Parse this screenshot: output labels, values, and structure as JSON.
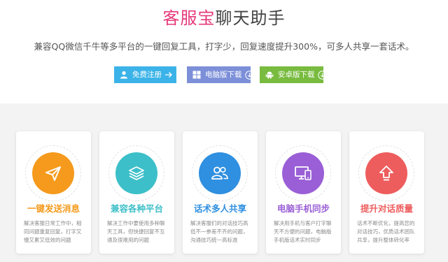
{
  "header": {
    "title_brand": "客服宝",
    "title_rest": "聊天助手",
    "subtitle": "兼容QQ微信千牛等多平台的一键回复工具，打字少，回复速度提升300%，可多人共享一套话术。",
    "brand_color": "#e6397a"
  },
  "buttons": [
    {
      "label": "免费注册",
      "icon": "user-icon",
      "tail_icon": "arrow-right-icon",
      "color": "#3bb3e8"
    },
    {
      "label": "电脑版下载",
      "icon": "windows-icon",
      "tail_icon": "download-icon",
      "color": "#7c8fd8"
    },
    {
      "label": "安卓版下载",
      "icon": "android-icon",
      "tail_icon": "download-icon",
      "color": "#78bb3f"
    }
  ],
  "features": [
    {
      "title": "一键发送消息",
      "desc": "解决客服日常工作中，相同问题重复回复，打字又慢又累又低效的问题",
      "icon": "paper-plane-icon",
      "color": "#f59a1c"
    },
    {
      "title": "兼容各种平台",
      "desc": "解决工作中要使用多种聊天工具，但快捷回复不互通及很难用的问题",
      "icon": "layers-icon",
      "color": "#3cbfc8"
    },
    {
      "title": "话术多人共享",
      "desc": "解决客服们的对话技巧高低不一参差不齐的问题，沟通技巧统一高标准",
      "icon": "users-icon",
      "color": "#2f8fe0"
    },
    {
      "title": "电脑手机同步",
      "desc": "解决用手机与客户打字聊天不方便的问题，电脑版手机版话术实时同步",
      "icon": "devices-icon",
      "color": "#9a5fd6"
    },
    {
      "title": "提升对话质量",
      "desc": "话术不断优化，提高您的对话技巧，优质话术团队共享，提升整体转化率",
      "icon": "arrow-up-icon",
      "color": "#ee5d5d"
    }
  ]
}
